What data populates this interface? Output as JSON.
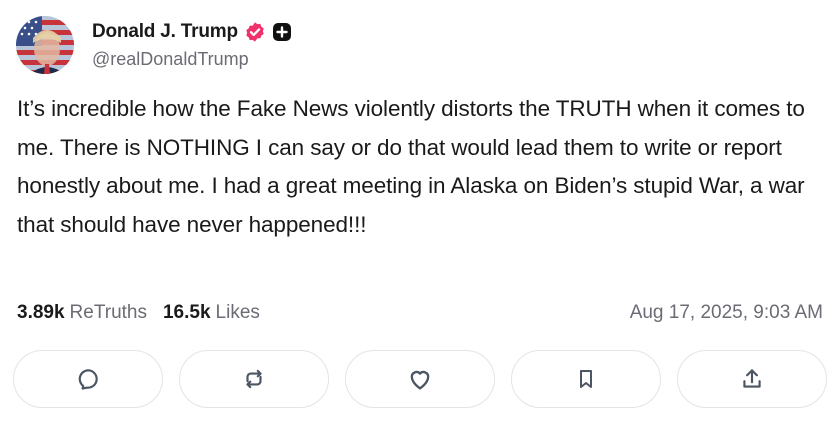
{
  "author": {
    "display_name": "Donald J. Trump",
    "handle": "@realDonaldTrump",
    "avatar_icon": "flag-portrait-avatar",
    "verified_icon": "verified-badge-icon",
    "plus_icon": "plus-badge-icon"
  },
  "post": {
    "text": "It’s incredible how the Fake News violently distorts the TRUTH when it comes to me. There is NOTHING I can say or do that would lead them to write or report honestly about me. I had a great meeting in Alaska on Biden’s stupid War, a war that should have never happened!!!"
  },
  "stats": {
    "retruths_count": "3.89k",
    "retruths_label": "ReTruths",
    "likes_count": "16.5k",
    "likes_label": "Likes",
    "timestamp": "Aug 17, 2025, 9:03 AM"
  },
  "actions": [
    {
      "name": "reply",
      "icon": "comment-icon"
    },
    {
      "name": "retruth",
      "icon": "repost-icon"
    },
    {
      "name": "like",
      "icon": "heart-icon"
    },
    {
      "name": "bookmark",
      "icon": "bookmark-icon"
    },
    {
      "name": "share",
      "icon": "share-icon"
    }
  ],
  "colors": {
    "verified": "#f0316b",
    "muted_text": "#6b6b75",
    "border": "#e3e3ea"
  }
}
